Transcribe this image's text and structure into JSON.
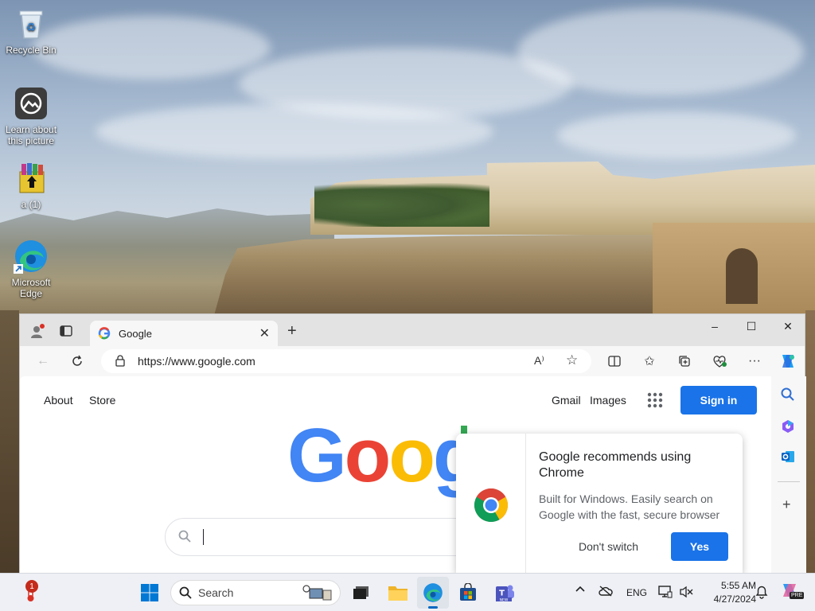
{
  "desktop": {
    "icons": [
      {
        "label": "Recycle Bin"
      },
      {
        "label": "Learn about this picture"
      },
      {
        "label": "a (1)"
      },
      {
        "label": "Microsoft Edge"
      }
    ]
  },
  "browser": {
    "tab_title": "Google",
    "url": "https://www.google.com",
    "window_controls": {
      "minimize": "–",
      "maximize": "☐",
      "close": "✕"
    }
  },
  "google": {
    "links_left": [
      "About",
      "Store"
    ],
    "links_right": [
      "Gmail",
      "Images"
    ],
    "sign_in": "Sign in",
    "logo_letters": [
      "G",
      "o",
      "o",
      "g"
    ],
    "logo_colors": [
      "#4285f4",
      "#ea4335",
      "#fbbc05",
      "#4285f4"
    ]
  },
  "popup": {
    "title": "Google recommends using Chrome",
    "body": "Built for Windows. Easily search on Google with the fast, secure browser",
    "dont_switch": "Don't switch",
    "yes": "Yes"
  },
  "taskbar": {
    "search_label": "Search",
    "language": "ENG",
    "time": "5:55 AM",
    "date": "4/27/2024",
    "notification_badge": "1",
    "copilot_badge": "PRE"
  },
  "colors": {
    "accent": "#1a73e8",
    "taskbar_bg": "#eef0f5"
  }
}
